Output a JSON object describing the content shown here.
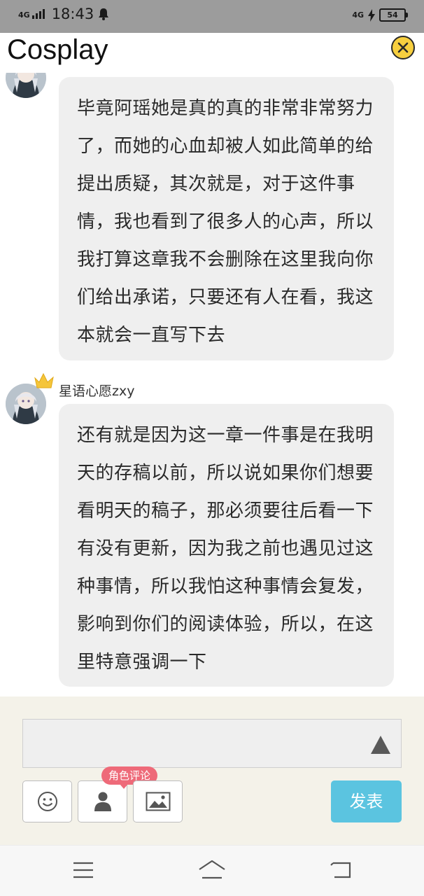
{
  "status_bar": {
    "network_left": "4G",
    "time": "18:43",
    "network_right": "4G",
    "battery": "54"
  },
  "header": {
    "title": "Cosplay"
  },
  "messages": [
    {
      "username": "",
      "text": "毕竟阿瑶她是真的真的非常非常努力了，而她的心血却被人如此简单的给提出质疑，其次就是，对于这件事情，我也看到了很多人的心声，所以我打算这章我不会删除在这里我向你们给出承诺，只要还有人在看，我这本就会一直写下去"
    },
    {
      "username": "星语心愿zxy",
      "text": "还有就是因为这一章一件事是在我明天的存稿以前，所以说如果你们想要看明天的稿子，那必须要往后看一下有没有更新，因为我之前也遇见过这种事情，所以我怕这种事情会复发，影响到你们的阅读体验，所以，在这里特意强调一下"
    }
  ],
  "composer": {
    "input_value": "",
    "role_comment_label": "角色评论",
    "publish_label": "发表"
  },
  "colors": {
    "close_button": "#f7cf3f",
    "publish_button": "#5bc4e0",
    "role_tag": "#ee6a79",
    "composer_bg": "#f4f2e9",
    "bubble_bg": "#efefef"
  },
  "icons": [
    "bell-icon",
    "close-icon",
    "crown-icon",
    "send-arrow-icon",
    "emoji-icon",
    "person-icon",
    "image-icon",
    "menu-icon",
    "home-icon",
    "back-icon"
  ]
}
